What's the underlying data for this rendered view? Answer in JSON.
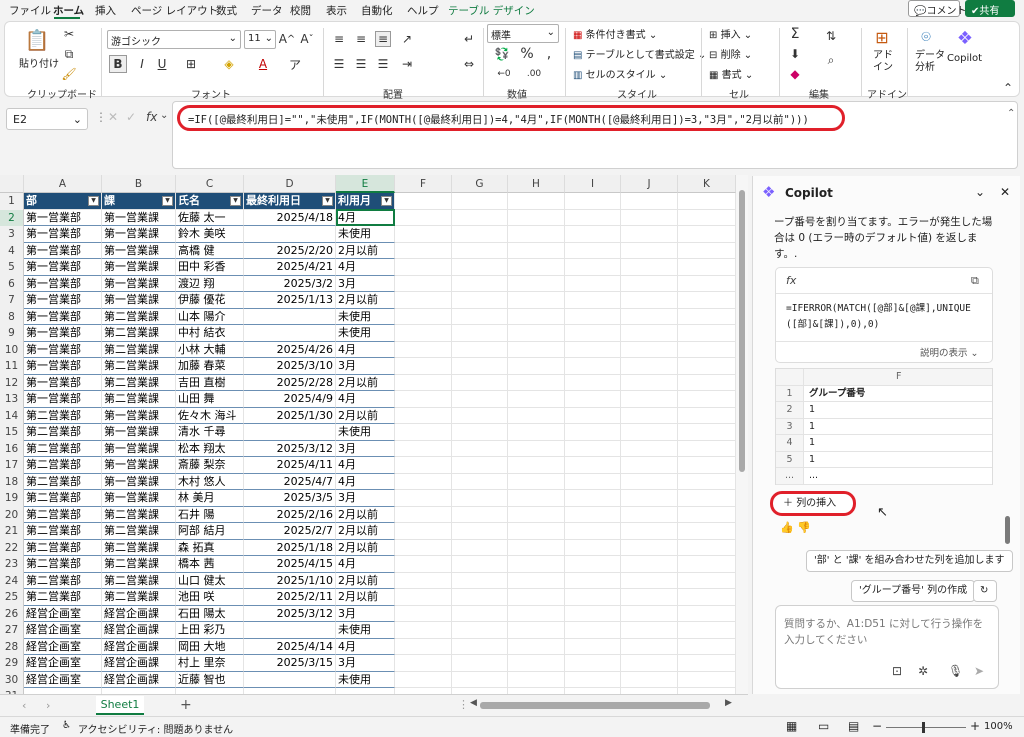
{
  "menu": {
    "items": [
      "ファイル",
      "ホーム",
      "挿入",
      "ページ レイアウト",
      "数式",
      "データ",
      "校閲",
      "表示",
      "自動化",
      "ヘルプ",
      "テーブル デザイン"
    ],
    "comment_button": "コメント",
    "share_button": "共有"
  },
  "ribbon": {
    "clipboard": {
      "label": "クリップボード",
      "paste": "貼り付け"
    },
    "font": {
      "label": "フォント",
      "font_name": "游ゴシック",
      "font_size": "11",
      "bold": "B",
      "italic": "I",
      "underline": "U"
    },
    "alignment": {
      "label": "配置"
    },
    "number": {
      "label": "数値",
      "format": "標準"
    },
    "styles": {
      "label": "スタイル",
      "conditional": "条件付き書式",
      "format_as_table": "テーブルとして書式設定",
      "cell_styles": "セルのスタイル"
    },
    "cells": {
      "label": "セル",
      "insert": "挿入",
      "delete": "削除",
      "format": "書式"
    },
    "editing": {
      "label": "編集"
    },
    "addins": {
      "label": "アドイン",
      "addins_btn": "アド\nイン"
    },
    "analyze": {
      "label": "データ\n分析"
    },
    "copilot": {
      "label": "Copilot"
    }
  },
  "formula_bar": {
    "name_box": "E2",
    "fx": "fx",
    "formula": "=IF([@最終利用日]=\"\",\"未使用\",IF(MONTH([@最終利用日])=4,\"4月\",IF(MONTH([@最終利用日])=3,\"3月\",\"2月以前\")))"
  },
  "sheet": {
    "columns": [
      "A",
      "B",
      "C",
      "D",
      "E",
      "F",
      "G",
      "H",
      "I",
      "J",
      "K"
    ],
    "headers": [
      "部",
      "課",
      "氏名",
      "最終利用日",
      "利用月"
    ],
    "rows": [
      [
        "第一営業部",
        "第一営業課",
        "佐藤 太一",
        "2025/4/18",
        "4月"
      ],
      [
        "第一営業部",
        "第一営業課",
        "鈴木 美咲",
        "",
        "未使用"
      ],
      [
        "第一営業部",
        "第一営業課",
        "高橋 健",
        "2025/2/20",
        "2月以前"
      ],
      [
        "第一営業部",
        "第一営業課",
        "田中 彩香",
        "2025/4/21",
        "4月"
      ],
      [
        "第一営業部",
        "第一営業課",
        "渡辺 翔",
        "2025/3/2",
        "3月"
      ],
      [
        "第一営業部",
        "第一営業課",
        "伊藤 優花",
        "2025/1/13",
        "2月以前"
      ],
      [
        "第一営業部",
        "第二営業課",
        "山本 陽介",
        "",
        "未使用"
      ],
      [
        "第一営業部",
        "第二営業課",
        "中村 結衣",
        "",
        "未使用"
      ],
      [
        "第一営業部",
        "第二営業課",
        "小林 大輔",
        "2025/4/26",
        "4月"
      ],
      [
        "第一営業部",
        "第二営業課",
        "加藤 春菜",
        "2025/3/10",
        "3月"
      ],
      [
        "第一営業部",
        "第二営業課",
        "吉田 直樹",
        "2025/2/28",
        "2月以前"
      ],
      [
        "第一営業部",
        "第二営業課",
        "山田 舞",
        "2025/4/9",
        "4月"
      ],
      [
        "第二営業部",
        "第一営業課",
        "佐々木 海斗",
        "2025/1/30",
        "2月以前"
      ],
      [
        "第二営業部",
        "第一営業課",
        "清水 千尋",
        "",
        "未使用"
      ],
      [
        "第二営業部",
        "第一営業課",
        "松本 翔太",
        "2025/3/12",
        "3月"
      ],
      [
        "第二営業部",
        "第一営業課",
        "斎藤 梨奈",
        "2025/4/11",
        "4月"
      ],
      [
        "第二営業部",
        "第一営業課",
        "木村 悠人",
        "2025/4/7",
        "4月"
      ],
      [
        "第二営業部",
        "第一営業課",
        "林 美月",
        "2025/3/5",
        "3月"
      ],
      [
        "第二営業部",
        "第二営業課",
        "石井 陽",
        "2025/2/16",
        "2月以前"
      ],
      [
        "第二営業部",
        "第二営業課",
        "阿部 結月",
        "2025/2/7",
        "2月以前"
      ],
      [
        "第二営業部",
        "第二営業課",
        "森 拓真",
        "2025/1/18",
        "2月以前"
      ],
      [
        "第二営業部",
        "第二営業課",
        "橋本 茜",
        "2025/4/15",
        "4月"
      ],
      [
        "第二営業部",
        "第二営業課",
        "山口 健太",
        "2025/1/10",
        "2月以前"
      ],
      [
        "第二営業部",
        "第二営業課",
        "池田 咲",
        "2025/2/11",
        "2月以前"
      ],
      [
        "経営企画室",
        "経営企画課",
        "石田 陽太",
        "2025/3/12",
        "3月"
      ],
      [
        "経営企画室",
        "経営企画課",
        "上田 彩乃",
        "",
        "未使用"
      ],
      [
        "経営企画室",
        "経営企画課",
        "岡田 大地",
        "2025/4/14",
        "4月"
      ],
      [
        "経営企画室",
        "経営企画課",
        "村上 里奈",
        "2025/3/15",
        "3月"
      ],
      [
        "経営企画室",
        "経営企画課",
        "近藤 智也",
        "",
        "未使用"
      ]
    ],
    "tab": "Sheet1"
  },
  "status": {
    "ready": "準備完了",
    "accessibility": "アクセシビリティ: 問題ありません",
    "zoom": "100%"
  },
  "copilot": {
    "title": "Copilot",
    "message": "ープ番号を割り当てます。エラーが発生した場合は 0 (エラー時のデフォルト値) を返します。.",
    "formula": "=IFERROR(MATCH([@部]&[@課],UNIQUE([部]&[課]),0),0)",
    "show_explanation": "説明の表示",
    "table_col": "F",
    "table_header": "グループ番号",
    "table_rows": [
      [
        "1",
        ""
      ],
      [
        "2",
        "1"
      ],
      [
        "3",
        "1"
      ],
      [
        "4",
        "1"
      ],
      [
        "5",
        "1"
      ],
      [
        "...",
        "..."
      ]
    ],
    "insert_column": "列の挿入",
    "suggestion1": "'部' と '課' を組み合わせた列を追加します",
    "suggestion2": "'グループ番号' 列の作成",
    "input_placeholder": "質問するか、A1:D51 に対して行う操作を入力してください"
  }
}
